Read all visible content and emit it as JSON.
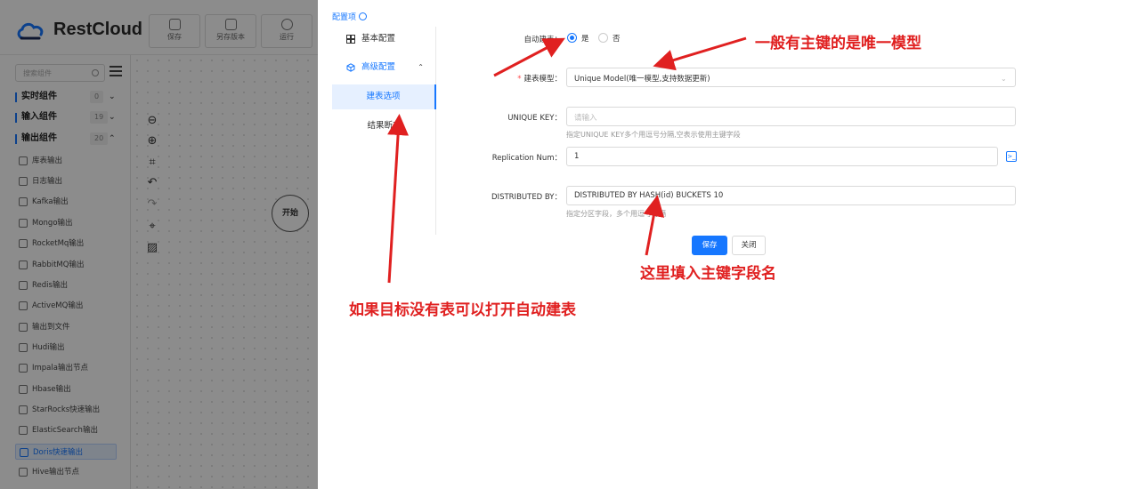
{
  "app": {
    "logo_text": "RestCloud",
    "toolbar": [
      {
        "label": "保存",
        "icon": "save-icon"
      },
      {
        "label": "另存版本",
        "icon": "copy-icon"
      },
      {
        "label": "运行",
        "icon": "run-icon"
      }
    ]
  },
  "sidebar": {
    "search_placeholder": "搜索组件",
    "groups": [
      {
        "label": "实时组件",
        "count": "0",
        "chevron": "⌄"
      },
      {
        "label": "输入组件",
        "count": "19",
        "chevron": "⌄"
      },
      {
        "label": "输出组件",
        "count": "20",
        "chevron": "⌃"
      }
    ],
    "items": [
      "库表输出",
      "日志输出",
      "Kafka输出",
      "Mongo输出",
      "RocketMq输出",
      "RabbitMQ输出",
      "Redis输出",
      "ActiveMQ输出",
      "输出到文件",
      "Hudi输出",
      "Impala输出节点",
      "Hbase输出",
      "StarRocks快速输出",
      "ElasticSearch输出",
      "Doris快速输出",
      "Hive输出节点"
    ],
    "selected_item": "Doris快速输出"
  },
  "canvas": {
    "start_node": "开始",
    "tools": [
      "zoom-out-icon",
      "zoom-in-icon",
      "fit-icon",
      "undo-icon",
      "redo-icon",
      "focus-icon",
      "grid-icon"
    ]
  },
  "drawer": {
    "title": "配置项",
    "nav": {
      "basic": "基本配置",
      "advanced": "高级配置",
      "sub_table_options": "建表选项",
      "sub_result": "结果断言"
    },
    "form": {
      "auto_create_label": "自动建表：",
      "auto_create_yes": "是",
      "auto_create_no": "否",
      "auto_create_value": "是",
      "model_label": "建表模型：",
      "model_value": "Unique Model(唯一模型,支持数据更新)",
      "unique_key_label": "UNIQUE KEY：",
      "unique_key_placeholder": "请输入",
      "unique_key_hint": "指定UNIQUE KEY多个用逗号分隔,空表示使用主键字段",
      "replication_label": "Replication Num：",
      "replication_value": "1",
      "distributed_label": "DISTRIBUTED BY：",
      "distributed_value": "DISTRIBUTED BY HASH(id) BUCKETS 10",
      "distributed_hint": "指定分区字段，多个用逗号分隔",
      "save_btn": "保存",
      "close_btn": "关闭"
    }
  },
  "annotations": {
    "top_right": "一般有主键的是唯一模型",
    "bottom_middle": "这里填入主键字段名",
    "bottom_left": "如果目标没有表可以打开自动建表",
    "color": "#e02020"
  }
}
